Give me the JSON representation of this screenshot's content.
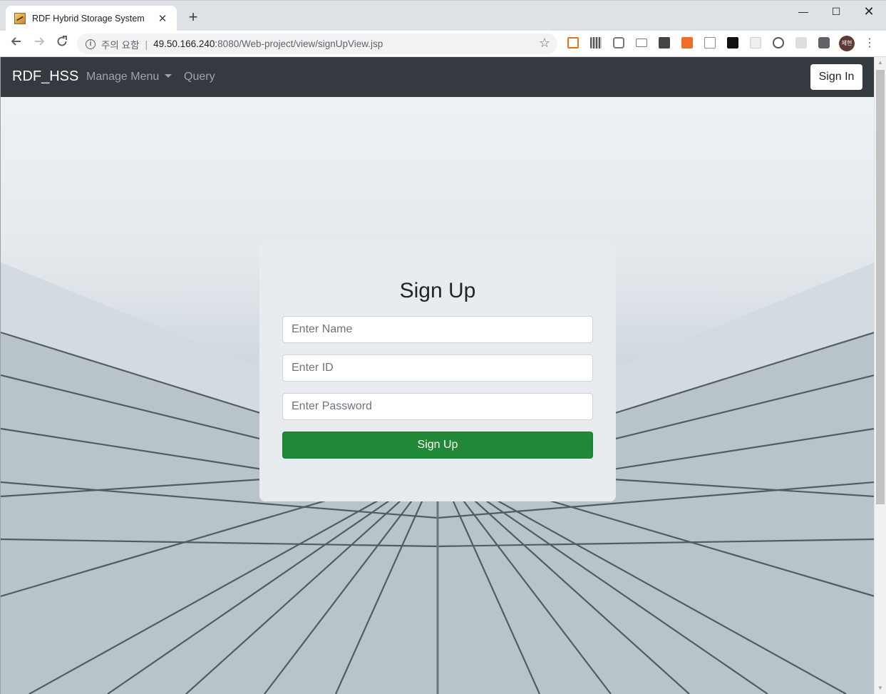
{
  "browser": {
    "tab_title": "RDF Hybrid Storage System",
    "tab_close": "✕",
    "new_tab": "+",
    "security_label": "주의 요함",
    "url_host": "49.50.166.240",
    "url_rest": ":8080/Web-project/view/signUpView.jsp",
    "profile_initials": "제현",
    "window_controls": {
      "minimize": "—",
      "maximize": "☐",
      "close": "✕"
    }
  },
  "navbar": {
    "brand": "RDF_HSS",
    "links": [
      {
        "label": "Manage Menu",
        "dropdown": true
      },
      {
        "label": "Query",
        "dropdown": false
      }
    ],
    "signin_label": "Sign In"
  },
  "form": {
    "title": "Sign Up",
    "name_placeholder": "Enter Name",
    "id_placeholder": "Enter ID",
    "password_placeholder": "Enter Password",
    "submit_label": "Sign Up"
  },
  "colors": {
    "navbar_bg": "#343a40",
    "card_bg": "#e9ecef",
    "submit_bg": "#218838"
  }
}
